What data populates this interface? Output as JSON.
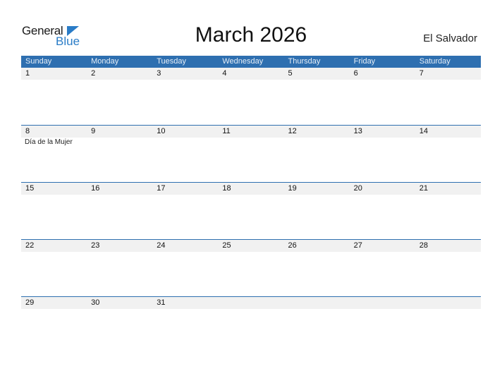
{
  "logo": {
    "word1": "General",
    "word2": "Blue"
  },
  "title": "March 2026",
  "country": "El Salvador",
  "colors": {
    "header_bg": "#2e6fb0",
    "accent": "#2a7cc7",
    "date_strip": "#f1f1f1"
  },
  "weekdays": [
    "Sunday",
    "Monday",
    "Tuesday",
    "Wednesday",
    "Thursday",
    "Friday",
    "Saturday"
  ],
  "weeks": [
    {
      "dates": [
        "1",
        "2",
        "3",
        "4",
        "5",
        "6",
        "7"
      ],
      "events": [
        "",
        "",
        "",
        "",
        "",
        "",
        ""
      ]
    },
    {
      "dates": [
        "8",
        "9",
        "10",
        "11",
        "12",
        "13",
        "14"
      ],
      "events": [
        "Día de la Mujer",
        "",
        "",
        "",
        "",
        "",
        ""
      ]
    },
    {
      "dates": [
        "15",
        "16",
        "17",
        "18",
        "19",
        "20",
        "21"
      ],
      "events": [
        "",
        "",
        "",
        "",
        "",
        "",
        ""
      ]
    },
    {
      "dates": [
        "22",
        "23",
        "24",
        "25",
        "26",
        "27",
        "28"
      ],
      "events": [
        "",
        "",
        "",
        "",
        "",
        "",
        ""
      ]
    },
    {
      "dates": [
        "29",
        "30",
        "31",
        "",
        "",
        "",
        ""
      ],
      "events": [
        "",
        "",
        "",
        "",
        "",
        "",
        ""
      ]
    }
  ]
}
